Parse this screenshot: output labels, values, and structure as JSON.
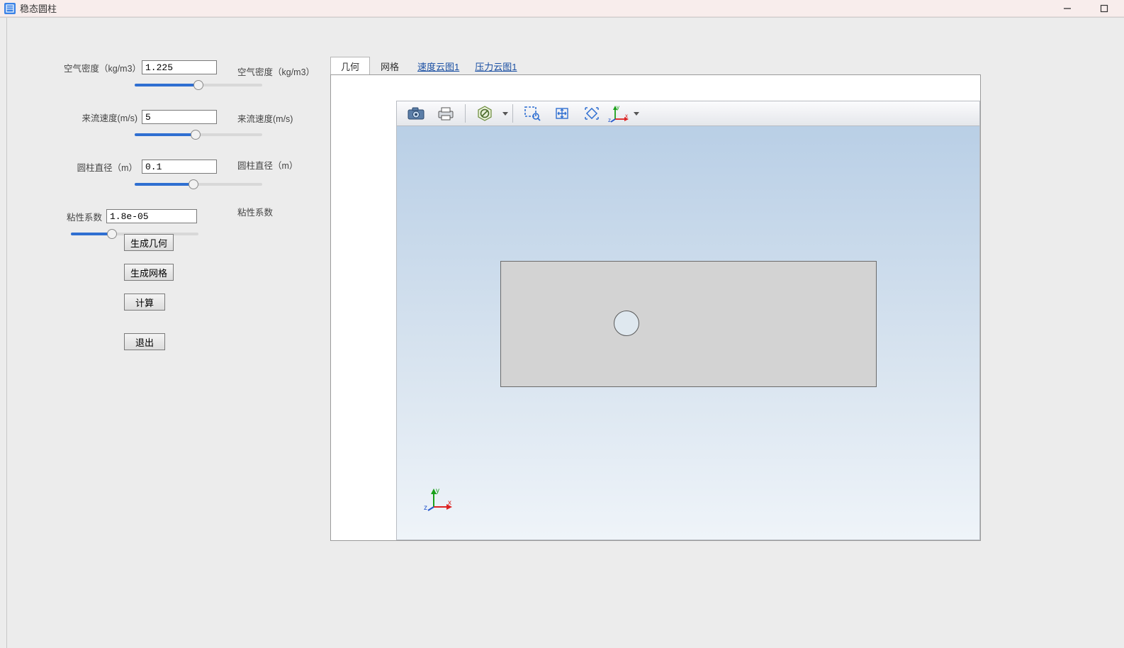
{
  "window": {
    "title": "稳态圆柱"
  },
  "params": {
    "air_density": {
      "label": "空气密度（kg/m3）",
      "value": "1.225",
      "slider_pct": 50
    },
    "velocity": {
      "label": "来流速度(m/s)",
      "value": "5",
      "slider_pct": 48
    },
    "diameter": {
      "label": "圆柱直径（m）",
      "value": "0.1",
      "slider_pct": 46
    },
    "viscosity": {
      "label": "粘性系数",
      "value": "1.8e-05",
      "slider_pct": 32
    }
  },
  "mirror_labels": {
    "air_density": "空气密度（kg/m3）",
    "velocity": "来流速度(m/s)",
    "diameter": "圆柱直径（m）",
    "viscosity": "粘性系数"
  },
  "buttons": {
    "gen_geom": "生成几何",
    "gen_mesh": "生成网格",
    "compute": "计算",
    "exit": "退出"
  },
  "tabs": {
    "geometry": "几何",
    "mesh": "网格",
    "velocity": "速度云图1",
    "pressure": "压力云图1"
  },
  "toolbar": {
    "snapshot": "snapshot",
    "print": "print",
    "no_entry": "disable",
    "zoom_box": "zoom-box",
    "pan": "pan",
    "fit": "fit",
    "triad": "triad"
  },
  "triad_axes": {
    "x": "x",
    "y": "y",
    "z": "z"
  }
}
